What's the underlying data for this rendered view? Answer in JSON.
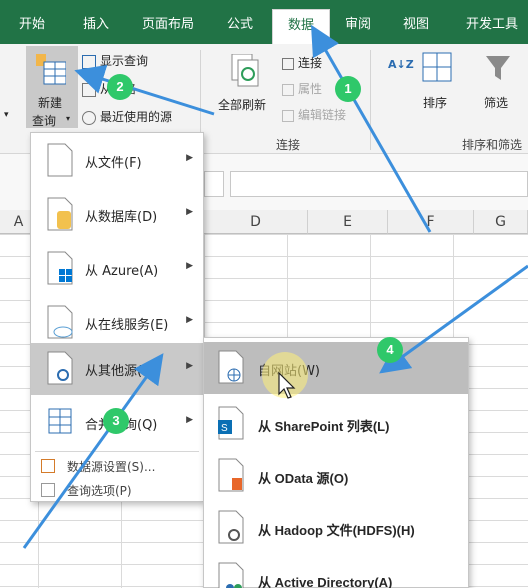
{
  "ribbon_tabs": [
    {
      "label": "开始"
    },
    {
      "label": "插入"
    },
    {
      "label": "页面布局"
    },
    {
      "label": "公式"
    },
    {
      "label": "数据",
      "active": true
    },
    {
      "label": "审阅"
    },
    {
      "label": "视图"
    },
    {
      "label": "开发工具"
    }
  ],
  "ribbon": {
    "new_query_line1": "新建",
    "new_query_line2": "查询",
    "show_queries": "显示查询",
    "from_table": "从表格",
    "recent_sources": "最近使用的源",
    "refresh_all": "全部刷新",
    "connections": "连接",
    "properties": "属性",
    "edit_links": "编辑链接",
    "connections_group": "连接",
    "sort_az": "A↓Z",
    "sort": "排序",
    "filter": "筛选",
    "sort_filter_group": "排序和筛选"
  },
  "columns": [
    "A",
    "D",
    "E",
    "F",
    "G"
  ],
  "menu": {
    "items": [
      {
        "label": "从文件(F)"
      },
      {
        "label": "从数据库(D)"
      },
      {
        "label": "从 Azure(A)"
      },
      {
        "label": "从在线服务(E)"
      },
      {
        "label": "从其他源(O)"
      },
      {
        "label": "合并查询(Q)"
      }
    ],
    "footer": [
      {
        "label": "数据源设置(S)..."
      },
      {
        "label": "查询选项(P)"
      }
    ]
  },
  "submenu": {
    "items": [
      {
        "label": "自网站(W)"
      },
      {
        "label": "从 SharePoint 列表(L)"
      },
      {
        "label": "从 OData 源(O)"
      },
      {
        "label": "从 Hadoop 文件(HDFS)(H)"
      },
      {
        "label": "从 Active Directory(A)"
      }
    ]
  },
  "badges": [
    "1",
    "2",
    "3",
    "4"
  ],
  "colors": {
    "accent": "#217346",
    "badge": "#2fc86a",
    "arrow": "#3c8fdc"
  }
}
